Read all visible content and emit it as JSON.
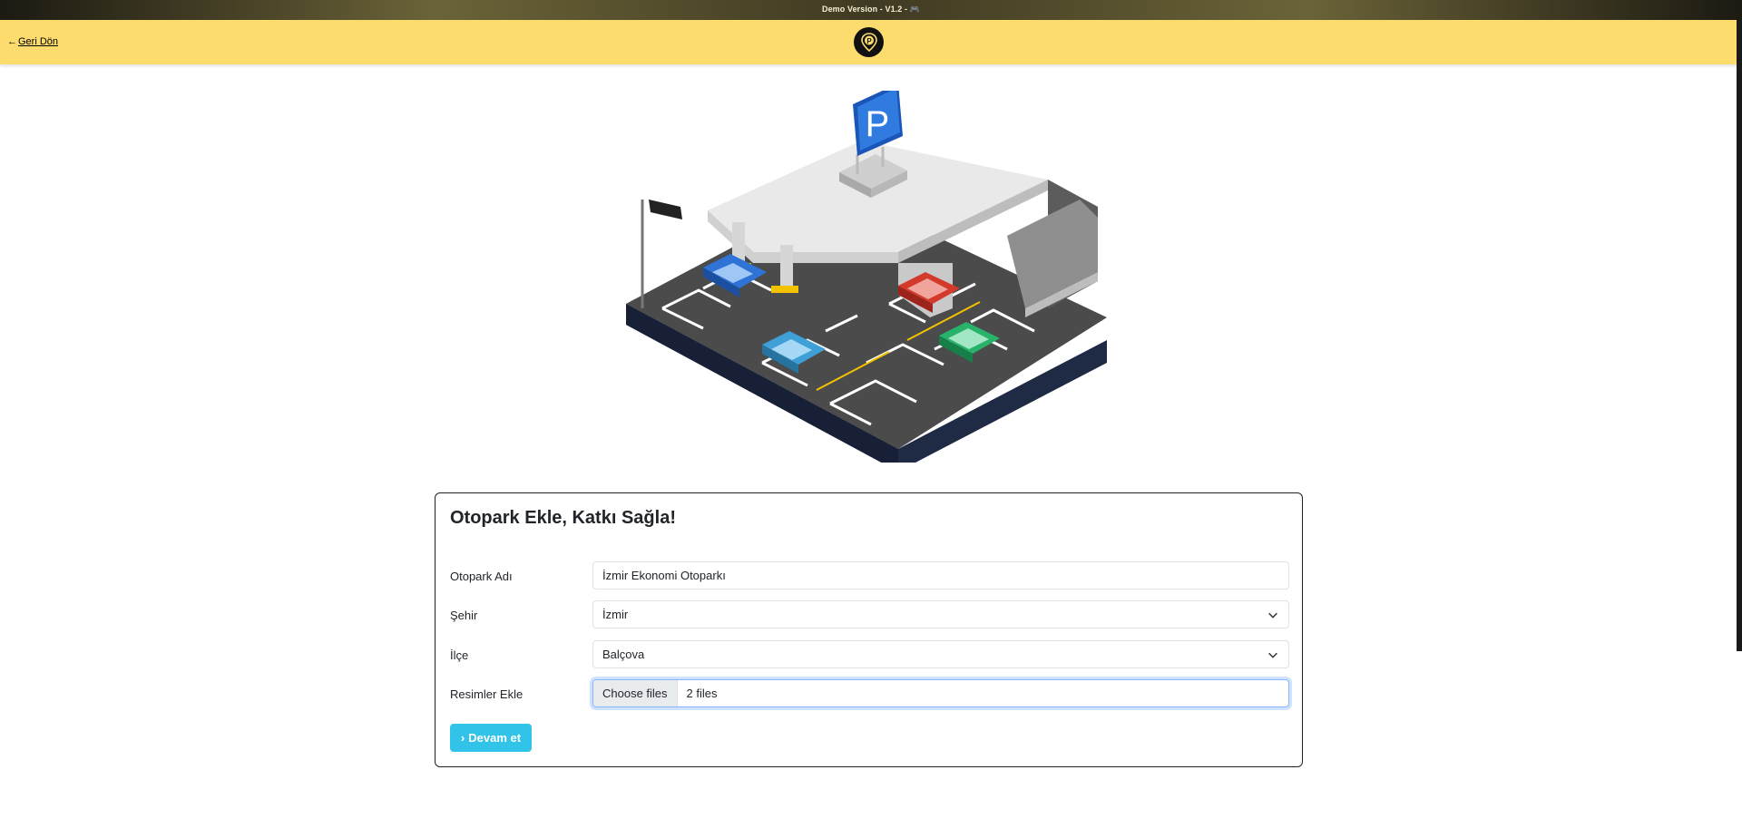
{
  "topbar": {
    "version_text": "Demo Version - V1.2 - 🎮"
  },
  "header": {
    "back_label": "Geri Dön",
    "logo_letter": "P"
  },
  "form": {
    "title": "Otopark Ekle, Katkı Sağla!",
    "name_label": "Otopark Adı",
    "name_value": "İzmir Ekonomi Otoparkı",
    "city_label": "Şehir",
    "city_value": "İzmir",
    "district_label": "İlçe",
    "district_value": "Balçova",
    "images_label": "Resimler Ekle",
    "file_button": "Choose files",
    "file_status": "2 files",
    "submit_label": "Devam et"
  },
  "colors": {
    "header_bg": "#fcdc6c",
    "submit_bg": "#31c3e8",
    "parking_sign": "#2f7be0"
  }
}
